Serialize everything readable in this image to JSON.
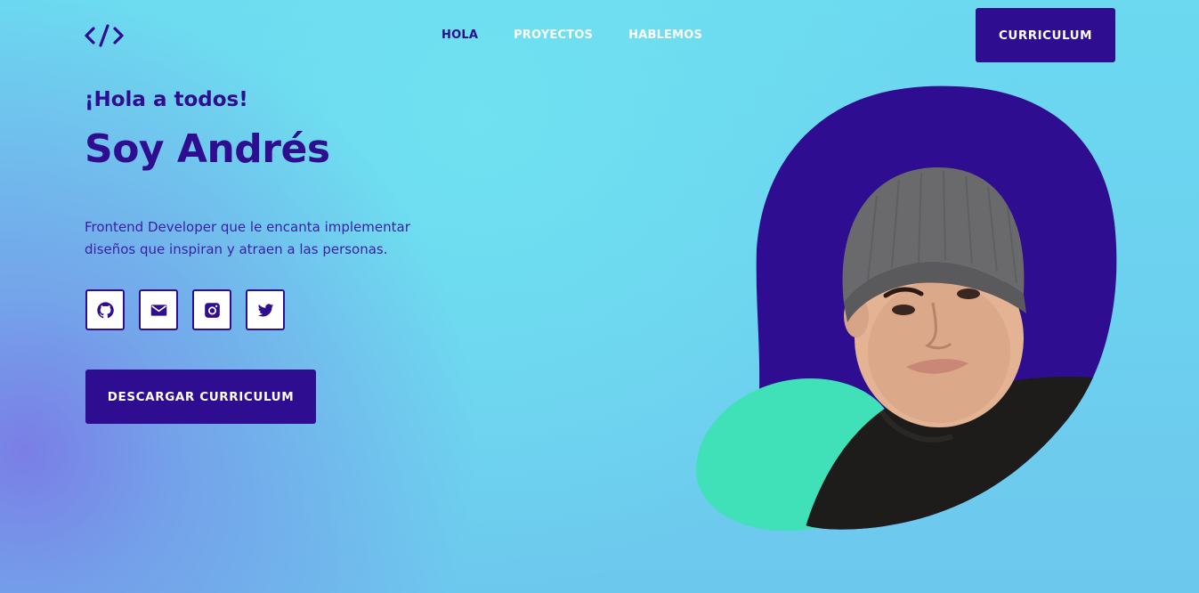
{
  "nav": {
    "logo_icon": "code-brackets-icon",
    "items": [
      {
        "label": "HOLA",
        "active": true
      },
      {
        "label": "PROYECTOS",
        "active": false
      },
      {
        "label": "HABLEMOS",
        "active": false
      }
    ],
    "cv_button": "CURRICULUM"
  },
  "hero": {
    "greeting": "¡Hola a todos!",
    "name": "Soy Andrés",
    "description_line1": "Frontend Developer que le encanta implementar",
    "description_line2": "diseños que inspiran y atraen a las personas.",
    "download_button": "DESCARGAR CURRICULUM"
  },
  "socials": [
    {
      "icon": "github-icon"
    },
    {
      "icon": "mail-icon"
    },
    {
      "icon": "instagram-icon"
    },
    {
      "icon": "twitter-icon"
    }
  ],
  "colors": {
    "primary": "#2e0d91",
    "accent_green": "#40e0b8",
    "background_cyan": "#6cd9f0"
  }
}
